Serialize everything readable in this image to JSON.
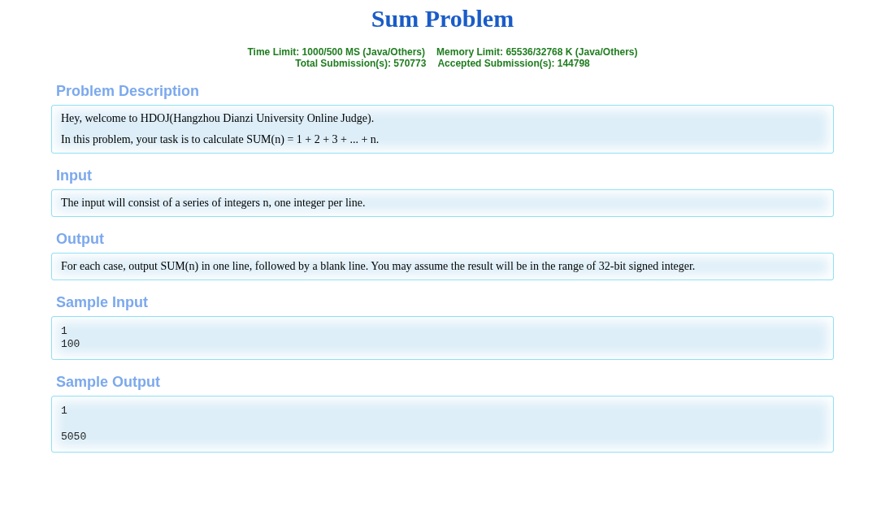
{
  "title": "Sum Problem",
  "limits": [
    {
      "text": "Time Limit: 1000/500 MS (Java/Others)"
    },
    {
      "text": "Memory Limit: 65536/32768 K (Java/Others)"
    }
  ],
  "submissions": [
    {
      "text": "Total Submission(s): 570773"
    },
    {
      "text": "Accepted Submission(s): 144798"
    }
  ],
  "sections": [
    {
      "heading": "Problem Description",
      "kind": "text",
      "paragraphs": [
        "Hey, welcome to HDOJ(Hangzhou Dianzi University Online Judge).",
        "In this problem, your task is to calculate SUM(n) = 1 + 2 + 3 + ... + n."
      ]
    },
    {
      "heading": "Input",
      "kind": "text",
      "paragraphs": [
        "The input will consist of a series of integers n, one integer per line."
      ]
    },
    {
      "heading": "Output",
      "kind": "text",
      "paragraphs": [
        "For each case, output SUM(n) in one line, followed by a blank line. You may assume the result will be in the range of 32-bit signed integer."
      ]
    },
    {
      "heading": "Sample Input",
      "kind": "code",
      "code": "1\n100"
    },
    {
      "heading": "Sample Output",
      "kind": "code",
      "code": "1\n\n5050"
    }
  ]
}
